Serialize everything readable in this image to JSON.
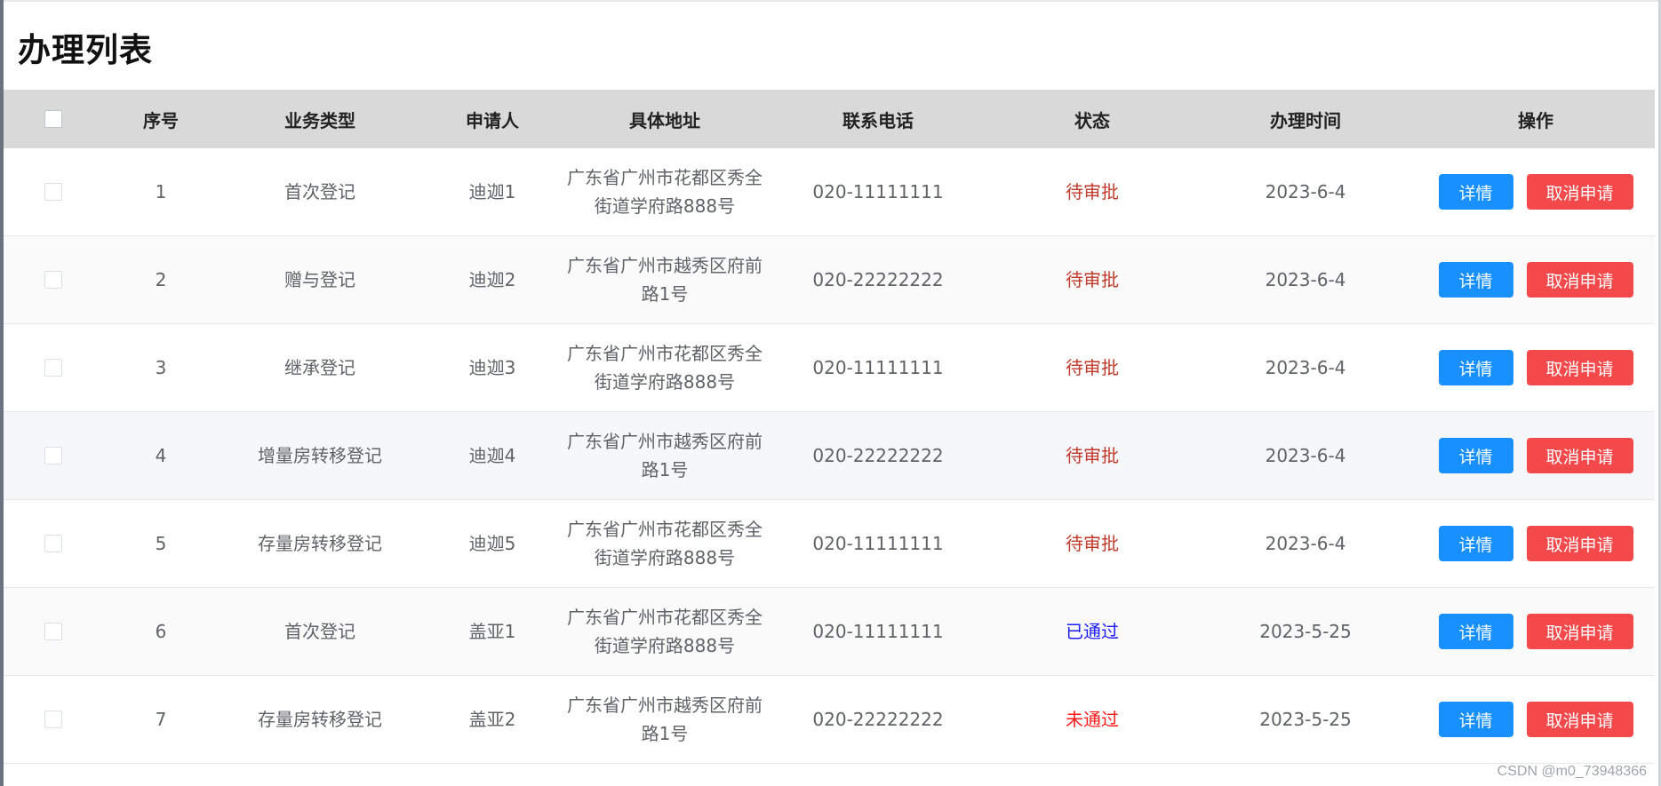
{
  "page": {
    "title": "办理列表",
    "watermark": "CSDN @m0_73948366"
  },
  "colors": {
    "status_pending": "#c0392b",
    "status_approved": "#1a1aff",
    "status_rejected": "#ff1a1a",
    "detail_button": "#1890ff",
    "cancel_button": "#f4494b",
    "header_bg": "#d9d9d9"
  },
  "table": {
    "headers": {
      "select": "",
      "index": "序号",
      "type": "业务类型",
      "applicant": "申请人",
      "address": "具体地址",
      "phone": "联系电话",
      "status": "状态",
      "time": "办理时间",
      "ops": "操作"
    },
    "actions": {
      "detail": "详情",
      "cancel": "取消申请"
    },
    "rows": [
      {
        "index": "1",
        "type": "首次登记",
        "applicant": "迪迦1",
        "address": "广东省广州市花都区秀全街道学府路888号",
        "phone": "020-11111111",
        "status": "待审批",
        "status_kind": "pending",
        "time": "2023-6-4"
      },
      {
        "index": "2",
        "type": "赠与登记",
        "applicant": "迪迦2",
        "address": "广东省广州市越秀区府前路1号",
        "phone": "020-22222222",
        "status": "待审批",
        "status_kind": "pending",
        "time": "2023-6-4"
      },
      {
        "index": "3",
        "type": "继承登记",
        "applicant": "迪迦3",
        "address": "广东省广州市花都区秀全街道学府路888号",
        "phone": "020-11111111",
        "status": "待审批",
        "status_kind": "pending",
        "time": "2023-6-4"
      },
      {
        "index": "4",
        "type": "增量房转移登记",
        "applicant": "迪迦4",
        "address": "广东省广州市越秀区府前路1号",
        "phone": "020-22222222",
        "status": "待审批",
        "status_kind": "pending",
        "time": "2023-6-4"
      },
      {
        "index": "5",
        "type": "存量房转移登记",
        "applicant": "迪迦5",
        "address": "广东省广州市花都区秀全街道学府路888号",
        "phone": "020-11111111",
        "status": "待审批",
        "status_kind": "pending",
        "time": "2023-6-4"
      },
      {
        "index": "6",
        "type": "首次登记",
        "applicant": "盖亚1",
        "address": "广东省广州市花都区秀全街道学府路888号",
        "phone": "020-11111111",
        "status": "已通过",
        "status_kind": "approved",
        "time": "2023-5-25"
      },
      {
        "index": "7",
        "type": "存量房转移登记",
        "applicant": "盖亚2",
        "address": "广东省广州市越秀区府前路1号",
        "phone": "020-22222222",
        "status": "未通过",
        "status_kind": "rejected",
        "time": "2023-5-25"
      }
    ]
  }
}
